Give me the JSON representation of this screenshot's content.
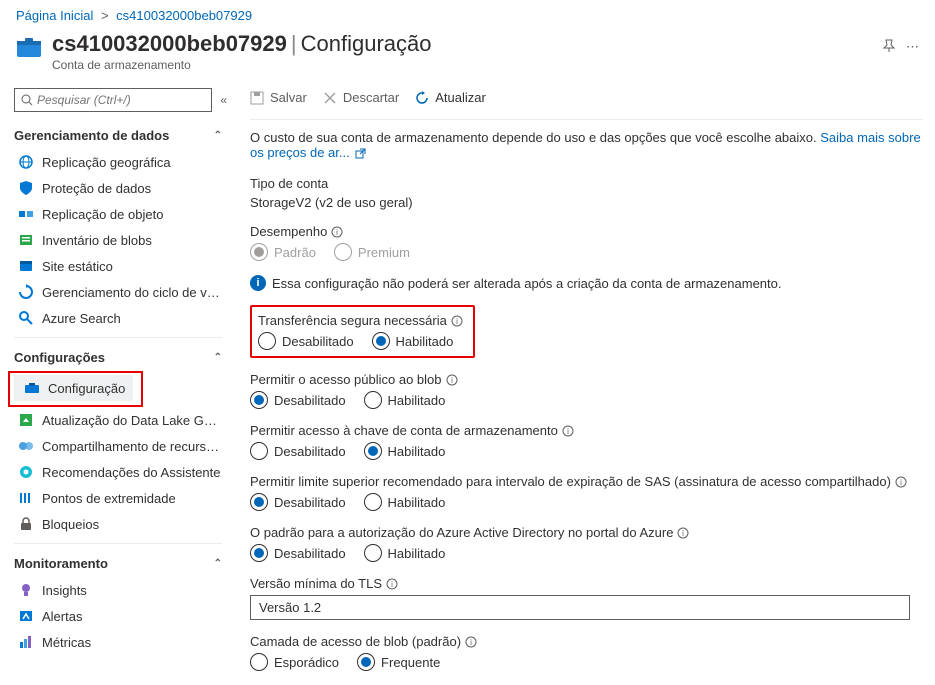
{
  "breadcrumb": {
    "home": "Página Inicial",
    "resource": "cs410032000beb07929"
  },
  "header": {
    "name": "cs410032000beb07929",
    "section": "Configuração",
    "subtype": "Conta de armazenamento"
  },
  "search": {
    "placeholder": "Pesquisar (Ctrl+/)"
  },
  "sections": {
    "data_mgmt": "Gerenciamento de dados",
    "settings": "Configurações",
    "monitoring": "Monitoramento"
  },
  "nav": {
    "geo_replication": "Replicação geográfica",
    "data_protection": "Proteção de dados",
    "object_replication": "Replicação de objeto",
    "blob_inventory": "Inventário de blobs",
    "static_site": "Site estático",
    "lifecycle": "Gerenciamento do ciclo de vida",
    "azure_search": "Azure Search",
    "configuration": "Configuração",
    "dlg2": "Atualização do Data Lake Gen2",
    "cors": "Compartilhamento de recursos (C...",
    "advisor": "Recomendações do Assistente",
    "endpoints": "Pontos de extremidade",
    "locks": "Bloqueios",
    "insights": "Insights",
    "alerts": "Alertas",
    "metrics": "Métricas"
  },
  "toolbar": {
    "save": "Salvar",
    "discard": "Descartar",
    "refresh": "Atualizar"
  },
  "content": {
    "cost_line": "O custo de sua conta de armazenamento depende do uso e das opções que você escolhe abaixo.",
    "pricing_link": "Saiba mais sobre os preços de ar...",
    "account_type_label": "Tipo de conta",
    "account_type_value": "StorageV2 (v2 de uso geral)",
    "performance_label": "Desempenho",
    "performance_options": {
      "standard": "Padrão",
      "premium": "Premium"
    },
    "perf_note": "Essa configuração não poderá ser alterada após a criação da conta de armazenamento.",
    "secure_transfer_label": "Transferência segura necessária",
    "common": {
      "disabled": "Desabilitado",
      "enabled": "Habilitado"
    },
    "blob_public_label": "Permitir o acesso público ao blob",
    "key_access_label": "Permitir acesso à chave de conta de armazenamento",
    "sas_limit_label": "Permitir limite superior recomendado para intervalo de expiração de SAS (assinatura de acesso compartilhado)",
    "aad_default_label": "O padrão para a autorização do Azure Active Directory no portal do Azure",
    "tls_label": "Versão mínima do TLS",
    "tls_value": "Versão 1.2",
    "tier_label": "Camada de acesso de blob (padrão)",
    "tier_options": {
      "cool": "Esporádico",
      "hot": "Frequente"
    }
  },
  "colors": {
    "accent": "#0067b8",
    "highlight": "#e60000"
  }
}
